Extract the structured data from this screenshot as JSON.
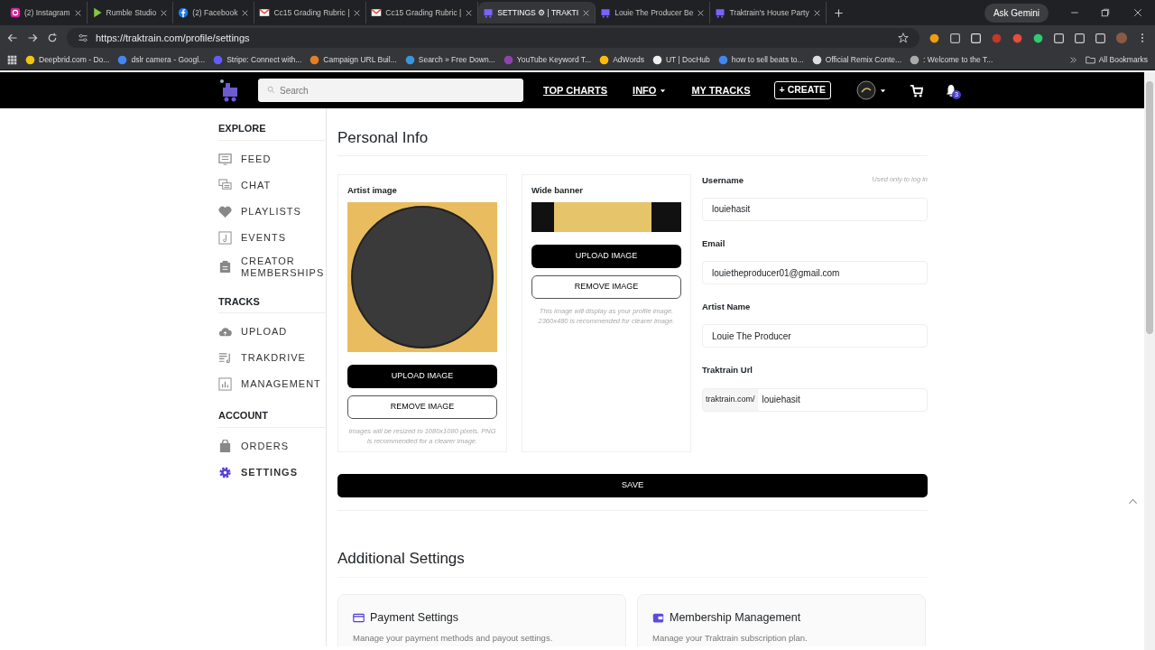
{
  "browser": {
    "tabs": [
      {
        "title": "(2) Instagram",
        "kind": "instagram",
        "selected": false
      },
      {
        "title": "Rumble Studio",
        "kind": "play",
        "selected": false
      },
      {
        "title": "(2) Facebook",
        "kind": "facebook",
        "selected": false
      },
      {
        "title": "Cc15 Grading Rubric |",
        "kind": "mail",
        "selected": false
      },
      {
        "title": "Cc15 Grading Rubric |",
        "kind": "mail",
        "selected": false
      },
      {
        "title": "SETTINGS ⚙ | TRAKTI",
        "kind": "train",
        "selected": true
      },
      {
        "title": "Louie The Producer Be",
        "kind": "train",
        "selected": false
      },
      {
        "title": "Traktrain's House Party",
        "kind": "train",
        "selected": false
      }
    ],
    "ask_button": "Ask Gemini",
    "url": "https://traktrain.com/profile/settings",
    "bookmarks": [
      "Deepbrid.com - Do...",
      "dslr camera - Googl...",
      "Stripe: Connect with...",
      "Campaign URL Buil...",
      "Search » Free Down...",
      "YouTube Keyword T...",
      "AdWords",
      "UT | DocHub",
      "how to sell beats to...",
      "Official Remix Conte...",
      ": Welcome to the T..."
    ],
    "all_bookmarks": "All Bookmarks"
  },
  "site": {
    "search": {
      "placeholder": "Search"
    },
    "nav": [
      {
        "label": "TOP CHARTS",
        "dropdown": false
      },
      {
        "label": "INFO",
        "dropdown": true
      },
      {
        "label": "MY TRACKS",
        "dropdown": false
      }
    ],
    "create_button": "+ CREATE",
    "notification_count": "3",
    "sidebar": [
      {
        "heading": "EXPLORE",
        "items": [
          {
            "label": "FEED",
            "kind": "feed",
            "selected": false
          },
          {
            "label": "CHAT",
            "kind": "chat",
            "selected": false
          },
          {
            "label": "PLAYLISTS",
            "kind": "heart",
            "selected": false
          },
          {
            "label": "EVENTS",
            "kind": "note",
            "selected": false
          },
          {
            "label": "CREATOR MEMBERSHIPS",
            "kind": "clipboard",
            "selected": false
          }
        ]
      },
      {
        "heading": "TRACKS",
        "items": [
          {
            "label": "UPLOAD",
            "kind": "cloud",
            "selected": false
          },
          {
            "label": "TRAKDRIVE",
            "kind": "list",
            "selected": false
          },
          {
            "label": "MANAGEMENT",
            "kind": "chart",
            "selected": false
          }
        ]
      },
      {
        "heading": "ACCOUNT",
        "items": [
          {
            "label": "ORDERS",
            "kind": "bag",
            "selected": false
          },
          {
            "label": "SETTINGS",
            "kind": "gear",
            "selected": true
          }
        ]
      }
    ],
    "personal_info": {
      "title": "Personal Info",
      "images": [
        {
          "label": "Artist image",
          "kind": "square",
          "upload": "UPLOAD IMAGE",
          "remove": "REMOVE IMAGE",
          "note": "Images will be resized to 1080x1080 pixels. PNG is recommended for a clearer image."
        },
        {
          "label": "Wide banner",
          "kind": "banner",
          "upload": "UPLOAD IMAGE",
          "remove": "REMOVE IMAGE",
          "note": "This image will display as your profile image. 2360x480 is recommended for clearer image."
        }
      ],
      "fields": [
        {
          "label": "Username",
          "hint": "Used only to log in",
          "value": "louiehasit"
        },
        {
          "label": "Email",
          "value": "louietheproducer01@gmail.com"
        },
        {
          "label": "Artist Name",
          "value": "Louie The Producer"
        },
        {
          "label": "Traktrain Url",
          "prefix": "traktrain.com/",
          "value": "louiehasit"
        }
      ],
      "save": "SAVE"
    },
    "additional": {
      "title": "Additional Settings",
      "cards": [
        {
          "title": "Payment Settings",
          "kind": "card",
          "text": "Manage your payment methods and payout settings."
        },
        {
          "title": "Membership Management",
          "kind": "wallet",
          "text": "Manage your Traktrain subscription plan."
        }
      ]
    }
  }
}
